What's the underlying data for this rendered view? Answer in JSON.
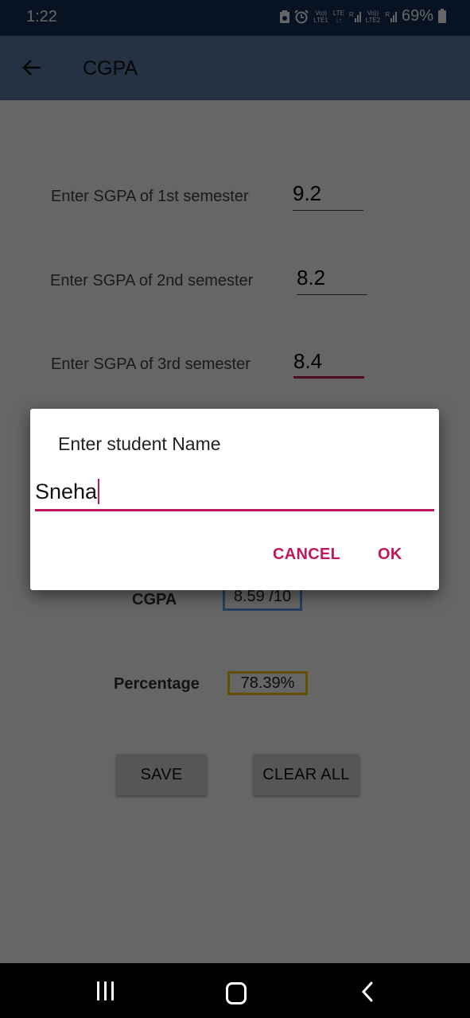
{
  "status_bar": {
    "time": "1:22",
    "icons": [
      "data-saver-icon",
      "alarm-icon",
      "volte-lte1-icon",
      "lte-arrows-icon",
      "signal-roaming-icon",
      "volte-lte2-icon",
      "signal-roaming-icon",
      "battery-icon"
    ],
    "volte1": "Vo))\nLTE1",
    "lte": "LTE",
    "volte2": "Vo))\nLTE2",
    "roaming": "R",
    "battery": "69%"
  },
  "app_bar": {
    "back_icon": "arrow-left-icon",
    "title": "CGPA"
  },
  "semesters": [
    {
      "label": "Enter SGPA of 1st semester",
      "value": "9.2"
    },
    {
      "label": "Enter SGPA of 2nd semester",
      "value": "8.2"
    },
    {
      "label": "Enter SGPA of 3rd semester",
      "value": "8.4"
    }
  ],
  "results": {
    "cgpa_label": "CGPA",
    "cgpa_value": "8.59 /10",
    "percentage_label": "Percentage",
    "percentage_value": "78.39%"
  },
  "buttons": {
    "save": "SAVE",
    "clear_all": "CLEAR ALL"
  },
  "dialog": {
    "title": "Enter student Name",
    "input_value": "Sneha",
    "cancel": "CANCEL",
    "ok": "OK"
  },
  "colors": {
    "status_bar": "#123059",
    "app_bar": "#5c7ea8",
    "accent": "#c2185b",
    "cgpa_border": "#5aa0e8",
    "percentage_border": "#f5c000"
  },
  "nav_bar": {
    "recents_icon": "recent-apps-icon",
    "home_icon": "home-icon",
    "back_icon": "back-chevron-icon"
  }
}
